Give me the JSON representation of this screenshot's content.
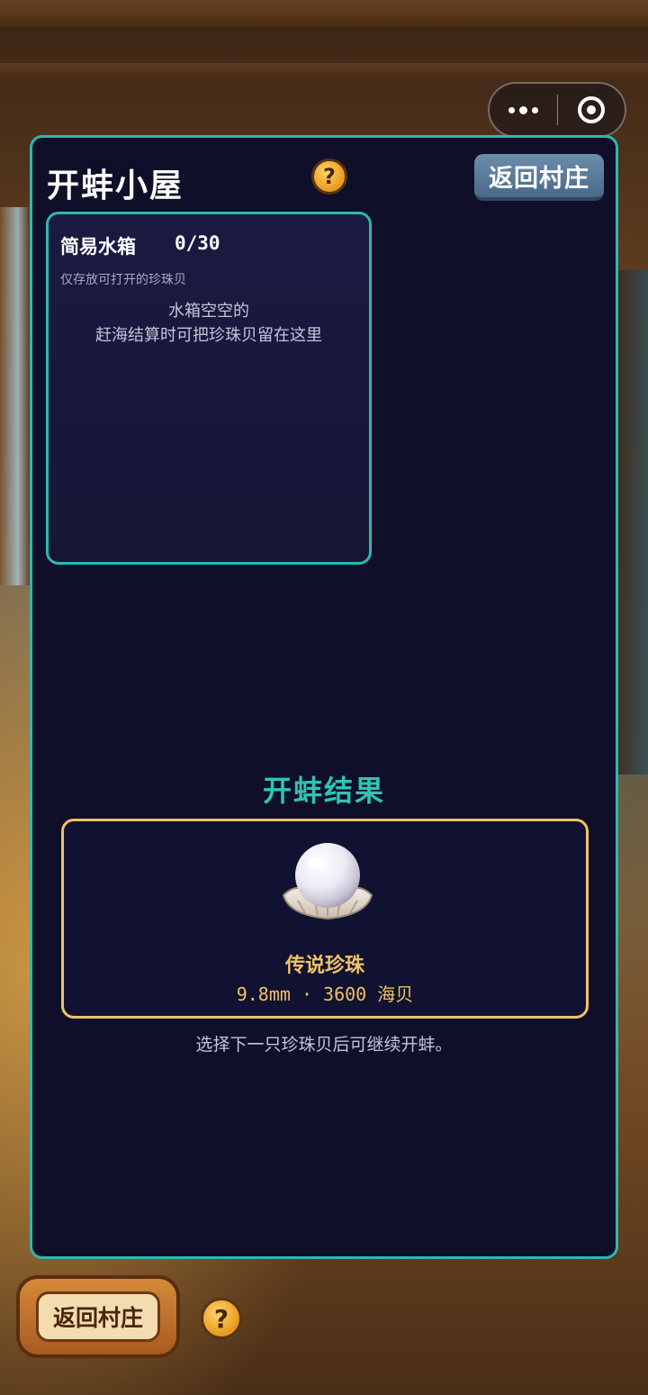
{
  "header": {
    "title": "开蚌小屋",
    "help_symbol": "?",
    "back_label": "返回村庄"
  },
  "tank": {
    "name": "简易水箱",
    "count": "0/30",
    "subtitle": "仅存放可打开的珍珠贝",
    "empty_line1": "水箱空空的",
    "empty_line2": "赶海结算时可把珍珠贝留在这里"
  },
  "result": {
    "title": "开蚌结果",
    "pearl_name": "传说珍珠",
    "pearl_info": "9.8mm · 3600 海贝",
    "hint": "选择下一只珍珠贝后可继续开蚌。"
  },
  "footer": {
    "back_label": "返回村庄",
    "help_symbol": "?"
  },
  "icons": {
    "more": "more-dots-icon",
    "close": "target-circle-icon",
    "help": "question-icon",
    "pearl": "pearl-in-shell-icon"
  },
  "colors": {
    "panel_bg": "#0f0f2a",
    "accent_teal": "#2fb8ad",
    "gold": "#f0c264"
  }
}
